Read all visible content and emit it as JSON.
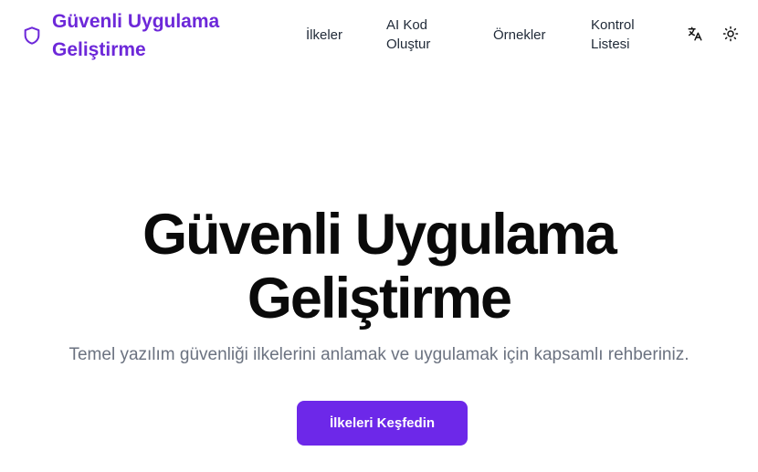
{
  "colors": {
    "brand": "#6d28d9",
    "button": "#6d28e9",
    "text": "#0a0a0a",
    "muted": "#6b7280"
  },
  "header": {
    "logo_icon": "shield-icon",
    "logo_line1": "Güvenli Uygulama",
    "logo_line2": "Geliştirme",
    "nav": {
      "principles": "İlkeler",
      "ai_line1": "AI Kod",
      "ai_line2": "Oluştur",
      "examples": "Örnekler",
      "checklist_line1": "Kontrol",
      "checklist_line2": "Listesi"
    },
    "translate_icon": "translate-icon",
    "theme_icon": "sun-icon"
  },
  "hero": {
    "title_line1": "Güvenli Uygulama",
    "title_line2": "Geliştirme",
    "subtitle": "Temel yazılım güvenliği ilkelerini anlamak ve uygulamak için kapsamlı rehberiniz.",
    "cta": "İlkeleri Keşfedin"
  }
}
